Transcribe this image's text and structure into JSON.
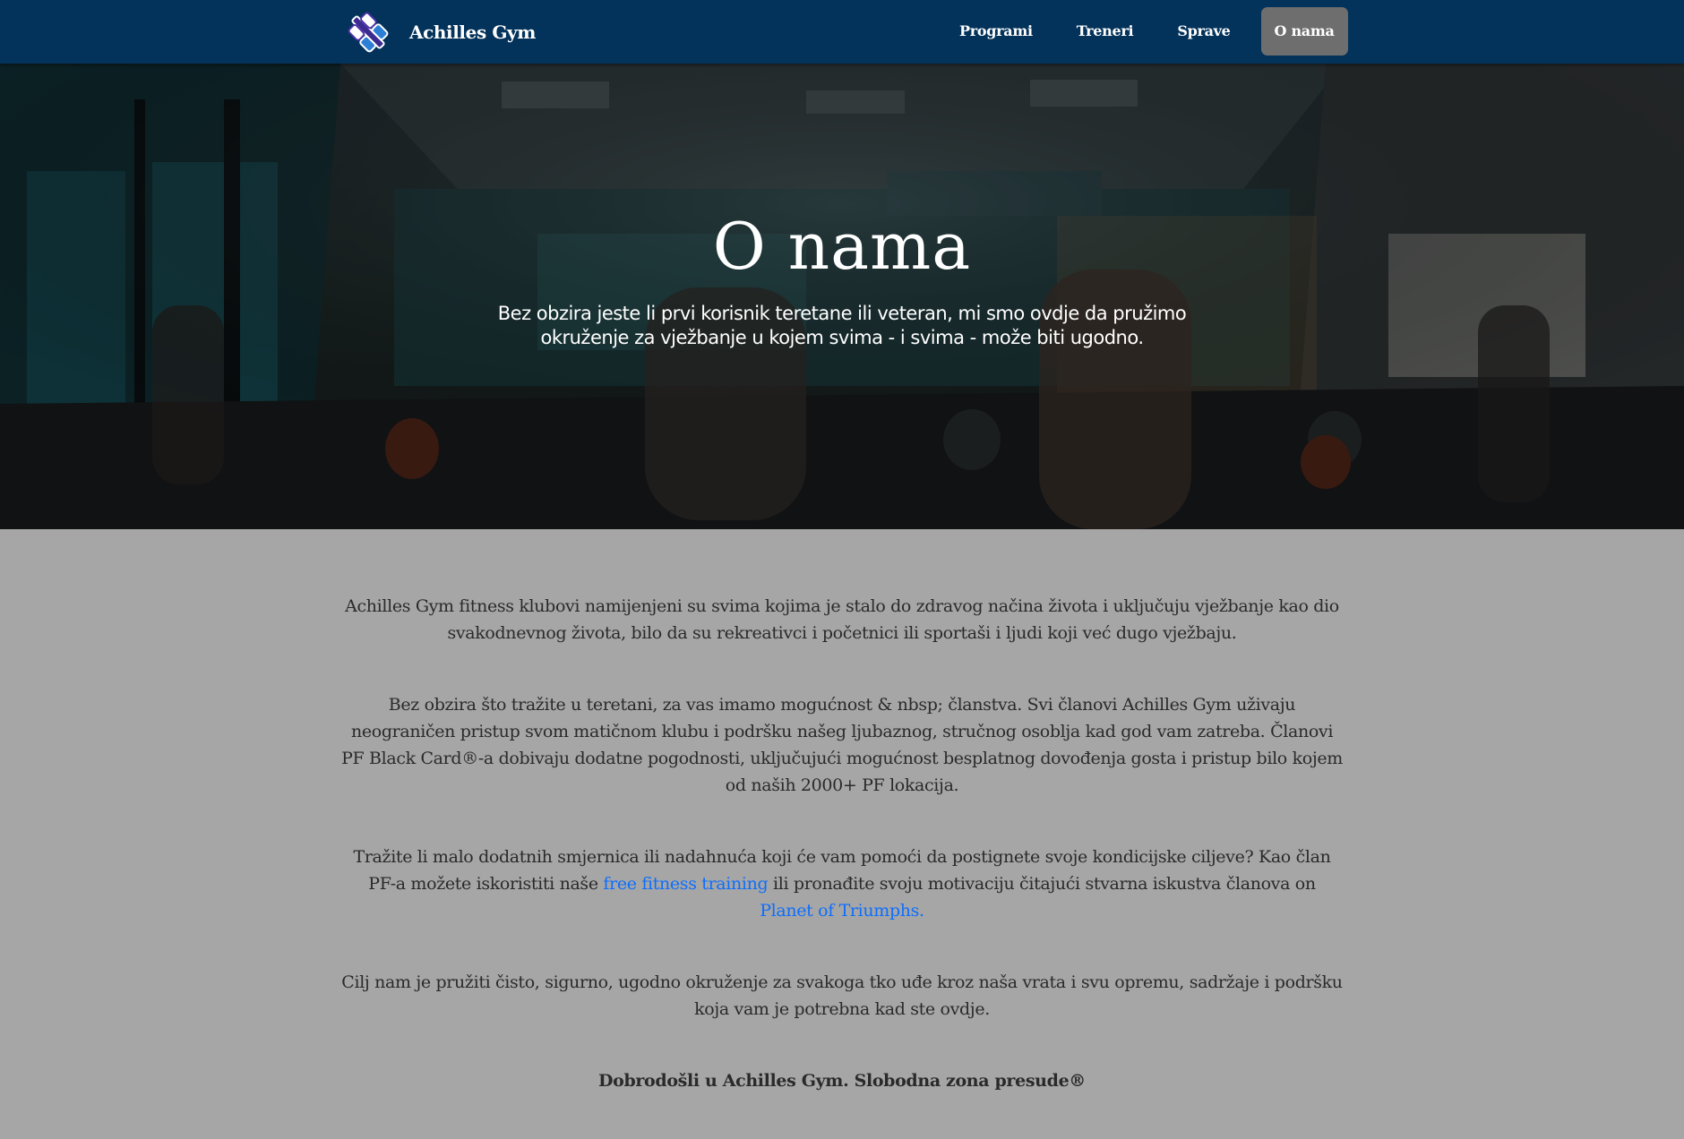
{
  "brand": {
    "name": "Achilles Gym",
    "logo": "dumbbell-logo-icon"
  },
  "nav": {
    "items": [
      {
        "label": "Programi",
        "active": false
      },
      {
        "label": "Treneri",
        "active": false
      },
      {
        "label": "Sprave",
        "active": false
      },
      {
        "label": "O nama",
        "active": true
      }
    ]
  },
  "hero": {
    "title": "O nama",
    "subtitle": "Bez obzira jeste li prvi korisnik teretane ili veteran, mi smo ovdje da pružimo okruženje za vježbanje u kojem svima - i svima - može biti ugodno.",
    "background": "gym-interior-photo"
  },
  "content": {
    "p1": "Achilles Gym fitness klubovi namijenjeni su svima kojima je stalo do zdravog načina života i uključuju vježbanje kao dio svakodnevnog života, bilo da su rekreativci i početnici ili sportaši i ljudi koji već dugo vježbaju.",
    "p2": "Bez obzira što tražite u teretani, za vas imamo mogućnost & nbsp; članstva. Svi članovi Achilles Gym uživaju neograničen pristup svom matičnom klubu i podršku našeg ljubaznog, stručnog osoblja kad god vam zatreba. Članovi PF Black Card®-a dobivaju dodatne pogodnosti, uključujući mogućnost besplatnog dovođenja gosta i pristup bilo kojem od naših 2000+ PF lokacija.",
    "p3_before": "Tražite li malo dodatnih smjernica ili nadahnuća koji će vam pomoći da postignete svoje kondicijske ciljeve? Kao član PF-a možete iskoristiti naše ",
    "p3_link1": "free fitness training",
    "p3_middle": " ili pronađite svoju motivaciju čitajući stvarna iskustva članova on ",
    "p3_link2": "Planet of Triumphs.",
    "p4": "Cilj nam je pružiti čisto, sigurno, ugodno okruženje za svakoga tko uđe kroz naša vrata i svu opremu, sadržaje i podršku koja vam je potrebna kad ste ovdje.",
    "p5": "Dobrodošli u Achilles Gym. Slobodna zona presude®"
  },
  "colors": {
    "navbar": "#03325a",
    "active_nav": "#6e6e6e",
    "page_background": "#a6a6a6",
    "link": "#0d6efd"
  }
}
